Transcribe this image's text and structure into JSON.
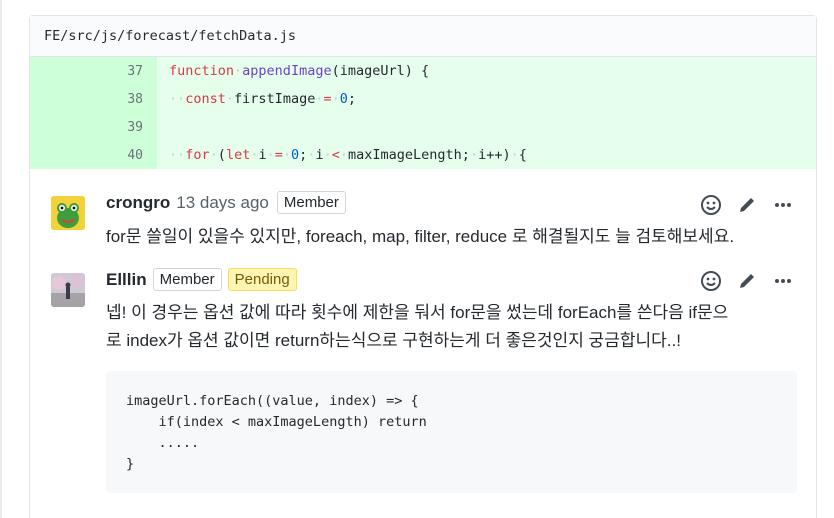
{
  "file": {
    "path": "FE/src/js/forecast/fetchData.js"
  },
  "diff": {
    "lines": [
      {
        "num": "37"
      },
      {
        "num": "38"
      },
      {
        "num": "39"
      },
      {
        "num": "40"
      }
    ],
    "tokens": {
      "l37_kw": "function",
      "l37_fn": "appendImage",
      "l37_rest": "(imageUrl) {",
      "l38_kw": "const",
      "l38_var": "firstImage",
      "l38_eq": "=",
      "l38_num": "0",
      "l38_end": ";",
      "l40_kw": "for",
      "l40_open": "(",
      "l40_let": "let",
      "l40_i": "i",
      "l40_eq": "=",
      "l40_zero": "0",
      "l40_semi": ";",
      "l40_cond_i": "i",
      "l40_lt": "<",
      "l40_max": "maxImageLength;",
      "l40_inc": "i++)",
      "l40_brace": "{"
    }
  },
  "comments": [
    {
      "author": "crongro",
      "time": "13 days ago",
      "badges": [
        "Member"
      ],
      "body": "for문 쓸일이 있을수 있지만, foreach, map, filter, reduce 로 해결될지도 늘 검토해보세요."
    },
    {
      "author": "Elllin",
      "badges": [
        "Member",
        "Pending"
      ],
      "body_line1": "넵! 이 경우는 옵션 값에 따라 횟수에 제한을 둬서 for문을 썼는데 forEach를 쓴다음 if문으",
      "body_line2": "로 index가 옵션 값이면 return하는식으로 구현하는게 더 좋은것인지 궁금합니다..!",
      "code_lines": [
        "imageUrl.forEach((value, index) => {",
        "    if(index < maxImageLength) return",
        "    .....",
        "}"
      ]
    }
  ],
  "icons": [
    "smiley-icon",
    "pencil-icon",
    "kebab-menu-icon"
  ],
  "colors": {
    "diff_add_bg": "#e6ffed",
    "diff_gutter_bg": "#cdffd8",
    "pending_bg": "#fff5b1"
  }
}
